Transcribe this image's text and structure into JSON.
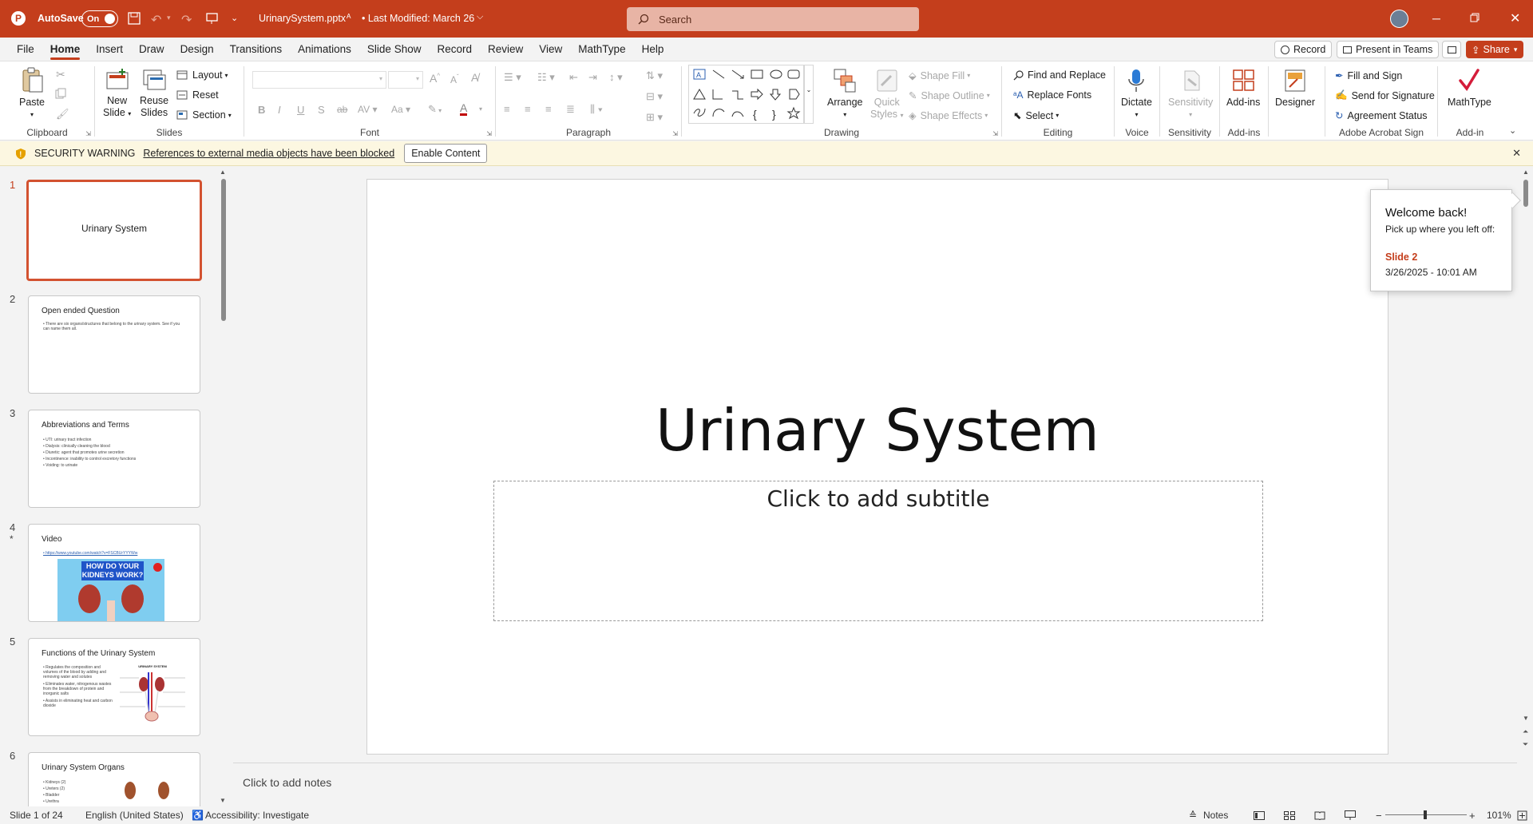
{
  "titlebar": {
    "autosave_label": "AutoSave",
    "autosave_state": "On",
    "filename": "UrinarySystem.pptx",
    "modified": "• Last Modified: March 26",
    "search_placeholder": "Search"
  },
  "menu": {
    "tabs": [
      "File",
      "Home",
      "Insert",
      "Draw",
      "Design",
      "Transitions",
      "Animations",
      "Slide Show",
      "Record",
      "Review",
      "View",
      "MathType",
      "Help"
    ],
    "active": "Home",
    "record_label": "Record",
    "present_label": "Present in Teams",
    "share_label": "Share"
  },
  "ribbon": {
    "clipboard": {
      "paste": "Paste",
      "label": "Clipboard"
    },
    "slides": {
      "new_slide_1": "New",
      "new_slide_2": "Slide",
      "reuse_1": "Reuse",
      "reuse_2": "Slides",
      "layout": "Layout",
      "reset": "Reset",
      "section": "Section",
      "label": "Slides"
    },
    "font": {
      "label": "Font"
    },
    "paragraph": {
      "label": "Paragraph"
    },
    "drawing": {
      "arrange": "Arrange",
      "quick_1": "Quick",
      "quick_2": "Styles",
      "shape_fill": "Shape Fill",
      "shape_outline": "Shape Outline",
      "shape_effects": "Shape Effects",
      "label": "Drawing"
    },
    "editing": {
      "find": "Find and Replace",
      "replace_fonts": "Replace Fonts",
      "select": "Select",
      "label": "Editing"
    },
    "voice": {
      "dictate": "Dictate",
      "label": "Voice"
    },
    "sensitivity": {
      "btn": "Sensitivity",
      "label": "Sensitivity"
    },
    "addins": {
      "btn": "Add-ins",
      "label": "Add-ins"
    },
    "designer": {
      "btn": "Designer"
    },
    "acrobat": {
      "fill": "Fill and Sign",
      "send": "Send for Signature",
      "status": "Agreement Status",
      "label": "Adobe Acrobat Sign"
    },
    "mathtype": {
      "btn": "MathType",
      "label": "Add-in"
    }
  },
  "warning": {
    "title": "SECURITY WARNING",
    "message": "References to external media objects have been blocked",
    "button": "Enable Content"
  },
  "thumbnails": [
    {
      "num": "1",
      "title": "Urinary System"
    },
    {
      "num": "2",
      "title": "Open ended Question",
      "body": "• There are six organs/structures that belong to the urinary system. See if you can name them all."
    },
    {
      "num": "3",
      "title": "Abbreviations and Terms",
      "bullets": [
        "• UTI: urinary tract infection",
        "• Dialysis: clinically cleaning the blood",
        "• Diuretic: agent that promotes urine secretion",
        "• Incontinence: inability to control excretory functions",
        "• Voiding: to urinate"
      ]
    },
    {
      "num": "4",
      "star": "*",
      "title": "Video",
      "link": "• https://www.youtube.com/watch?v=FSCBUrYYYWw",
      "video_text_1": "HOW DO YOUR",
      "video_text_2": "KIDNEYS WORK?"
    },
    {
      "num": "5",
      "title": "Functions of the Urinary System",
      "bullets": [
        "• Regulates the composition and volumes of the blood by adding and removing water and solutes",
        "• Eliminates water, nitrogenous wastes from the breakdown of protein and inorganic salts",
        "• Assists in eliminating heat and carbon dioxide"
      ],
      "diagram_title": "URINARY SYSTEM"
    },
    {
      "num": "6",
      "title": "Urinary System Organs",
      "bullets": [
        "• Kidneys (2)",
        "• Ureters (2)",
        "• Bladder",
        "• Urethra"
      ]
    }
  ],
  "slide": {
    "title": "Urinary System",
    "subtitle_placeholder": "Click to add subtitle"
  },
  "popup": {
    "heading": "Welcome back!",
    "text": "Pick up where you left off:",
    "slide": "Slide 2",
    "date": "3/26/2025 - 10:01 AM"
  },
  "notes": {
    "placeholder": "Click to add notes"
  },
  "status": {
    "slide": "Slide 1 of 24",
    "language": "English (United States)",
    "accessibility": "Accessibility: Investigate",
    "notes": "Notes",
    "zoom": "101%"
  },
  "colors": {
    "accent": "#c43e1c",
    "selected": "#d35230",
    "popup_link": "#c43e1c"
  }
}
